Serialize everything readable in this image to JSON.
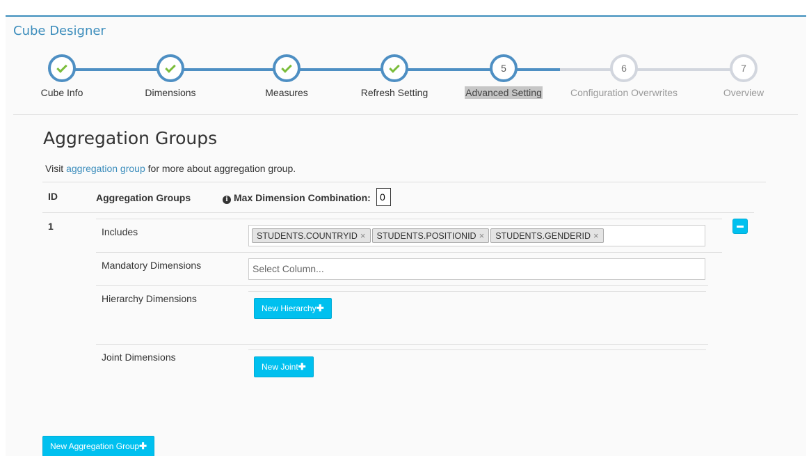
{
  "header": {
    "title": "Cube Designer"
  },
  "wizard": {
    "steps": [
      {
        "number": "1",
        "label": "Cube Info",
        "state": "done"
      },
      {
        "number": "2",
        "label": "Dimensions",
        "state": "done"
      },
      {
        "number": "3",
        "label": "Measures",
        "state": "done"
      },
      {
        "number": "4",
        "label": "Refresh Setting",
        "state": "done"
      },
      {
        "number": "5",
        "label": "Advanced Setting",
        "state": "active"
      },
      {
        "number": "6",
        "label": "Configuration Overwrites",
        "state": "todo"
      },
      {
        "number": "7",
        "label": "Overview",
        "state": "todo"
      }
    ],
    "colors": {
      "done": "#4e8fc3",
      "todo": "#d2d6de",
      "check": "#7bbd3b"
    }
  },
  "section": {
    "title": "Aggregation Groups",
    "visit_prefix": "Visit",
    "visit_link": "aggregation group",
    "visit_suffix": "for more about aggregation group."
  },
  "table": {
    "col_id": "ID",
    "col_groups": "Aggregation Groups",
    "max_label": "Max Dimension Combination:",
    "max_value": "0"
  },
  "group": {
    "id": "1",
    "includes_label": "Includes",
    "includes": [
      "STUDENTS.COUNTRYID",
      "STUDENTS.POSITIONID",
      "STUDENTS.GENDERID"
    ],
    "mandatory_label": "Mandatory Dimensions",
    "mandatory_placeholder": "Select Column...",
    "hierarchy_label": "Hierarchy Dimensions",
    "hierarchy_button": "New Hierarchy",
    "joint_label": "Joint Dimensions",
    "joint_button": "New Joint"
  },
  "footer": {
    "new_group_button": "New Aggregation Group"
  },
  "colors": {
    "accent": "#3c8dbc",
    "button": "#00c0ef"
  }
}
